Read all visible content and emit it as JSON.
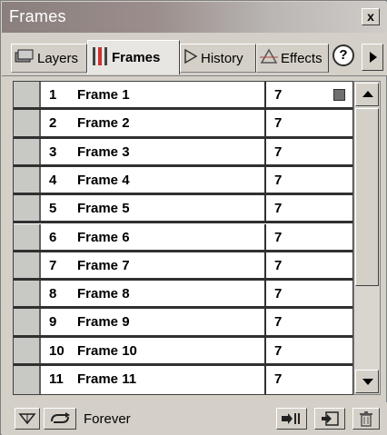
{
  "window": {
    "title": "Frames",
    "close_label": "x"
  },
  "tabs": [
    {
      "label": "Layers",
      "icon": "layers-icon"
    },
    {
      "label": "Frames",
      "icon": "frames-icon"
    },
    {
      "label": "History",
      "icon": "history-icon"
    },
    {
      "label": "Effects",
      "icon": "effects-icon"
    }
  ],
  "help_label": "?",
  "frames": [
    {
      "number": "1",
      "name": "Frame 1",
      "delay": "7"
    },
    {
      "number": "2",
      "name": "Frame 2",
      "delay": "7"
    },
    {
      "number": "3",
      "name": "Frame 3",
      "delay": "7"
    },
    {
      "number": "4",
      "name": "Frame 4",
      "delay": "7"
    },
    {
      "number": "5",
      "name": "Frame 5",
      "delay": "7"
    },
    {
      "number": "6",
      "name": "Frame 6",
      "delay": "7"
    },
    {
      "number": "7",
      "name": "Frame 7",
      "delay": "7"
    },
    {
      "number": "8",
      "name": "Frame 8",
      "delay": "7"
    },
    {
      "number": "9",
      "name": "Frame 9",
      "delay": "7"
    },
    {
      "number": "10",
      "name": "Frame 10",
      "delay": "7"
    },
    {
      "number": "11",
      "name": "Frame 11",
      "delay": "7"
    }
  ],
  "status": {
    "loop_label": "Forever"
  }
}
